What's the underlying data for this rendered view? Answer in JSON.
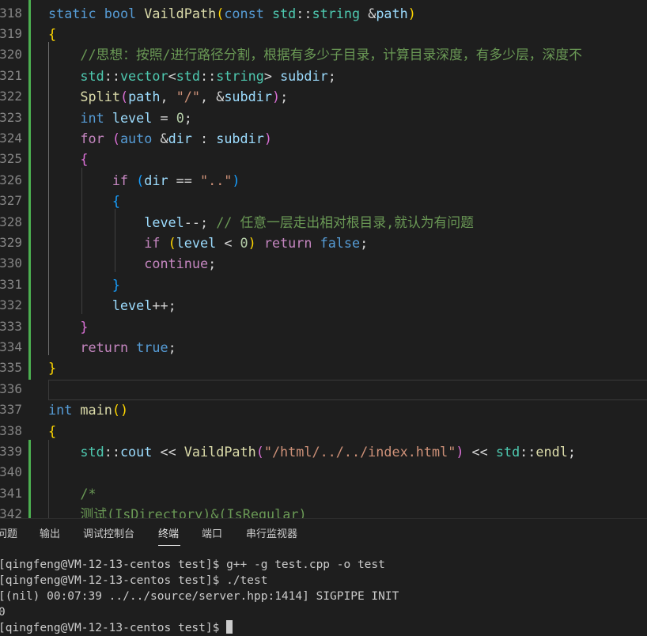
{
  "editor": {
    "lines": [
      {
        "n": "318",
        "t": [
          [
            "kw",
            "static"
          ],
          [
            "pn",
            " "
          ],
          [
            "kw",
            "bool"
          ],
          [
            "pn",
            " "
          ],
          [
            "fn",
            "VaildPath"
          ],
          [
            "b1",
            "("
          ],
          [
            "kw",
            "const"
          ],
          [
            "pn",
            " "
          ],
          [
            "ty",
            "std"
          ],
          [
            "pn",
            "::"
          ],
          [
            "ty",
            "string"
          ],
          [
            "pn",
            " &"
          ],
          [
            "var",
            "path"
          ],
          [
            "b1",
            ")"
          ]
        ]
      },
      {
        "n": "319",
        "t": [
          [
            "b1",
            "{"
          ]
        ]
      },
      {
        "n": "320",
        "t": [
          [
            "pn",
            "    "
          ],
          [
            "cmt",
            "//思想：按照/进行路径分割，根据有多少子目录，计算目录深度，有多少层，深度不"
          ]
        ]
      },
      {
        "n": "321",
        "t": [
          [
            "pn",
            "    "
          ],
          [
            "ty",
            "std"
          ],
          [
            "pn",
            "::"
          ],
          [
            "ty",
            "vector"
          ],
          [
            "pn",
            "<"
          ],
          [
            "ty",
            "std"
          ],
          [
            "pn",
            "::"
          ],
          [
            "ty",
            "string"
          ],
          [
            "pn",
            "> "
          ],
          [
            "var",
            "subdir"
          ],
          [
            "pn",
            ";"
          ]
        ]
      },
      {
        "n": "322",
        "t": [
          [
            "pn",
            "    "
          ],
          [
            "fn",
            "Split"
          ],
          [
            "b2",
            "("
          ],
          [
            "var",
            "path"
          ],
          [
            "pn",
            ", "
          ],
          [
            "str",
            "\"/\""
          ],
          [
            "pn",
            ", &"
          ],
          [
            "var",
            "subdir"
          ],
          [
            "b2",
            ")"
          ],
          [
            "pn",
            ";"
          ]
        ]
      },
      {
        "n": "323",
        "t": [
          [
            "pn",
            "    "
          ],
          [
            "kw",
            "int"
          ],
          [
            "pn",
            " "
          ],
          [
            "var",
            "level"
          ],
          [
            "pn",
            " = "
          ],
          [
            "num",
            "0"
          ],
          [
            "pn",
            ";"
          ]
        ]
      },
      {
        "n": "324",
        "t": [
          [
            "pn",
            "    "
          ],
          [
            "ctl",
            "for"
          ],
          [
            "pn",
            " "
          ],
          [
            "b2",
            "("
          ],
          [
            "kw",
            "auto"
          ],
          [
            "pn",
            " &"
          ],
          [
            "var",
            "dir"
          ],
          [
            "pn",
            " : "
          ],
          [
            "var",
            "subdir"
          ],
          [
            "b2",
            ")"
          ]
        ]
      },
      {
        "n": "325",
        "t": [
          [
            "pn",
            "    "
          ],
          [
            "b2",
            "{"
          ]
        ]
      },
      {
        "n": "326",
        "t": [
          [
            "pn",
            "        "
          ],
          [
            "ctl",
            "if"
          ],
          [
            "pn",
            " "
          ],
          [
            "b3",
            "("
          ],
          [
            "var",
            "dir"
          ],
          [
            "pn",
            " == "
          ],
          [
            "str",
            "\"..\""
          ],
          [
            "b3",
            ")"
          ]
        ]
      },
      {
        "n": "327",
        "t": [
          [
            "pn",
            "        "
          ],
          [
            "b3",
            "{"
          ]
        ]
      },
      {
        "n": "328",
        "t": [
          [
            "pn",
            "            "
          ],
          [
            "var",
            "level"
          ],
          [
            "pn",
            "--; "
          ],
          [
            "cmt",
            "// 任意一层走出相对根目录,就认为有问题"
          ]
        ]
      },
      {
        "n": "329",
        "t": [
          [
            "pn",
            "            "
          ],
          [
            "ctl",
            "if"
          ],
          [
            "pn",
            " "
          ],
          [
            "b1",
            "("
          ],
          [
            "var",
            "level"
          ],
          [
            "pn",
            " < "
          ],
          [
            "num",
            "0"
          ],
          [
            "b1",
            ")"
          ],
          [
            "pn",
            " "
          ],
          [
            "ctl",
            "return"
          ],
          [
            "pn",
            " "
          ],
          [
            "kw",
            "false"
          ],
          [
            "pn",
            ";"
          ]
        ]
      },
      {
        "n": "330",
        "t": [
          [
            "pn",
            "            "
          ],
          [
            "ctl",
            "continue"
          ],
          [
            "pn",
            ";"
          ]
        ]
      },
      {
        "n": "331",
        "t": [
          [
            "pn",
            "        "
          ],
          [
            "b3",
            "}"
          ]
        ]
      },
      {
        "n": "332",
        "t": [
          [
            "pn",
            "        "
          ],
          [
            "var",
            "level"
          ],
          [
            "pn",
            "++;"
          ]
        ]
      },
      {
        "n": "333",
        "t": [
          [
            "pn",
            "    "
          ],
          [
            "b2",
            "}"
          ]
        ]
      },
      {
        "n": "334",
        "t": [
          [
            "pn",
            "    "
          ],
          [
            "ctl",
            "return"
          ],
          [
            "pn",
            " "
          ],
          [
            "kw",
            "true"
          ],
          [
            "pn",
            ";"
          ]
        ]
      },
      {
        "n": "335",
        "t": [
          [
            "b1",
            "}"
          ]
        ]
      },
      {
        "n": "336",
        "t": []
      },
      {
        "n": "337",
        "t": [
          [
            "kw",
            "int"
          ],
          [
            "pn",
            " "
          ],
          [
            "fn",
            "main"
          ],
          [
            "b1",
            "()"
          ]
        ]
      },
      {
        "n": "338",
        "t": [
          [
            "b1",
            "{"
          ]
        ]
      },
      {
        "n": "339",
        "t": [
          [
            "pn",
            "    "
          ],
          [
            "ty",
            "std"
          ],
          [
            "pn",
            "::"
          ],
          [
            "var",
            "cout"
          ],
          [
            "pn",
            " << "
          ],
          [
            "fn",
            "VaildPath"
          ],
          [
            "b2",
            "("
          ],
          [
            "str",
            "\"/html/../../index.html\""
          ],
          [
            "b2",
            ")"
          ],
          [
            "pn",
            " << "
          ],
          [
            "ty",
            "std"
          ],
          [
            "pn",
            "::"
          ],
          [
            "fn",
            "endl"
          ],
          [
            "pn",
            ";"
          ]
        ]
      },
      {
        "n": "340",
        "t": []
      },
      {
        "n": "341",
        "t": [
          [
            "pn",
            "    "
          ],
          [
            "cmt",
            "/*"
          ]
        ]
      },
      {
        "n": "342",
        "t": [
          [
            "pn",
            "    "
          ],
          [
            "cmt",
            "测试(IsDirectory)&(IsRegular)"
          ]
        ]
      }
    ]
  },
  "panel": {
    "tabs": [
      {
        "label": "问题",
        "active": false
      },
      {
        "label": "输出",
        "active": false
      },
      {
        "label": "调试控制台",
        "active": false
      },
      {
        "label": "终端",
        "active": true
      },
      {
        "label": "端口",
        "active": false
      },
      {
        "label": "串行监视器",
        "active": false
      }
    ],
    "terminal": [
      "[qingfeng@VM-12-13-centos test]$ g++ -g test.cpp -o test",
      "[qingfeng@VM-12-13-centos test]$ ./test",
      "[(nil) 00:07:39 ../../source/server.hpp:1414] SIGPIPE INIT",
      "0",
      "[qingfeng@VM-12-13-centos test]$ "
    ]
  },
  "colors": {
    "background": "#1e1e1e",
    "line_number": "#858585",
    "modified_gutter": "#4caf50"
  }
}
